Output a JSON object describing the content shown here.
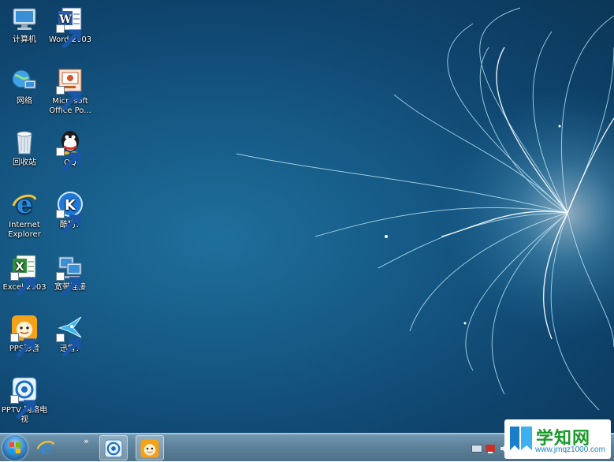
{
  "desktop": {
    "icons": [
      {
        "label": "计算机",
        "icon": "computer-icon"
      },
      {
        "label": "Word 2003",
        "icon": "word-icon"
      },
      {
        "label": "网络",
        "icon": "network-icon"
      },
      {
        "label": "Microsoft Office Po...",
        "icon": "powerpoint-icon"
      },
      {
        "label": "回收站",
        "icon": "recycle-bin-icon"
      },
      {
        "label": "QQ",
        "icon": "qq-icon"
      },
      {
        "label": "Internet Explorer",
        "icon": "ie-icon"
      },
      {
        "label": "酷狗7",
        "icon": "kugou-icon"
      },
      {
        "label": "Excel 2003",
        "icon": "excel-icon"
      },
      {
        "label": "宽带连接",
        "icon": "broadband-icon"
      },
      {
        "label": "PPS影音",
        "icon": "pps-icon"
      },
      {
        "label": "迅雷7",
        "icon": "xunlei-icon"
      },
      {
        "label": "PPTV 网络电视",
        "icon": "pptv-icon"
      }
    ]
  },
  "taskbar": {
    "overflow_label": "»",
    "buttons": [
      "start-icon",
      "ie-icon",
      "pptv-icon",
      "pps-icon"
    ]
  },
  "watermark": {
    "title": "学知网",
    "url": "www.jmqz1000.com"
  },
  "colors": {
    "accent": "#1a9a2a",
    "link": "#1a7fc8"
  }
}
